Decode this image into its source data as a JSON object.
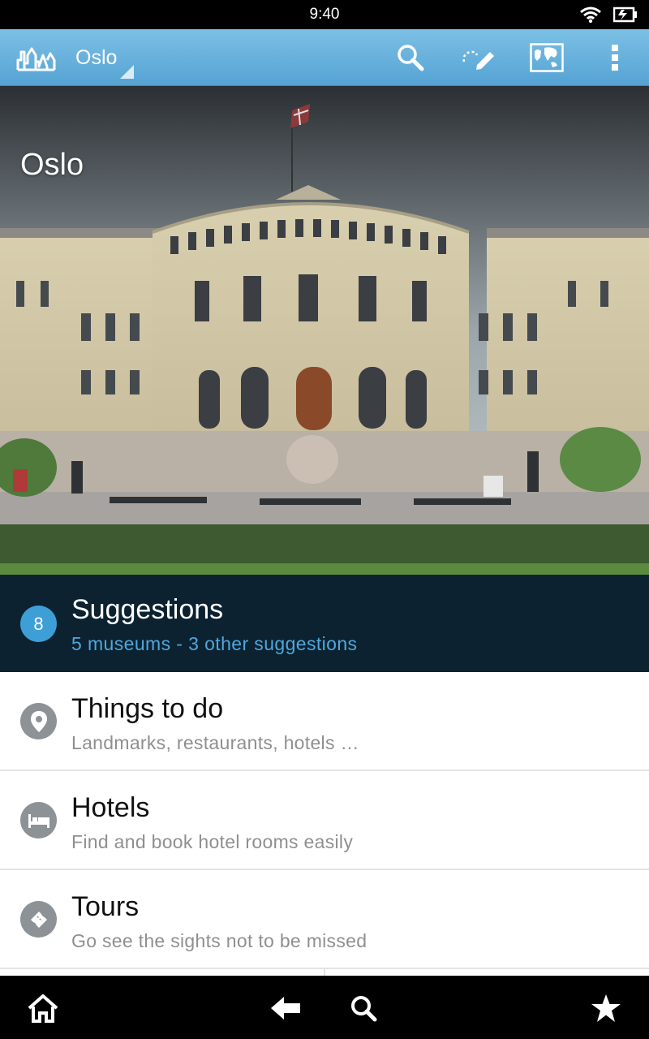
{
  "status": {
    "time": "9:40"
  },
  "action_bar": {
    "title": "Oslo"
  },
  "hero": {
    "title": "Oslo"
  },
  "suggestions": {
    "count": "8",
    "title": "Suggestions",
    "subtitle": "5 museums - 3 other suggestions"
  },
  "items": [
    {
      "title": "Things to do",
      "subtitle": "Landmarks, restaurants, hotels …",
      "icon": "location-pin-icon"
    },
    {
      "title": "Hotels",
      "subtitle": "Find and book hotel rooms easily",
      "icon": "bed-icon"
    },
    {
      "title": "Tours",
      "subtitle": "Go see the sights not to be missed",
      "icon": "ticket-icon"
    }
  ],
  "colors": {
    "action_bar": "#62acdb",
    "suggestions_bg": "#0c2230",
    "accent": "#3d9fd6",
    "icon_circle": "#8d9296"
  }
}
